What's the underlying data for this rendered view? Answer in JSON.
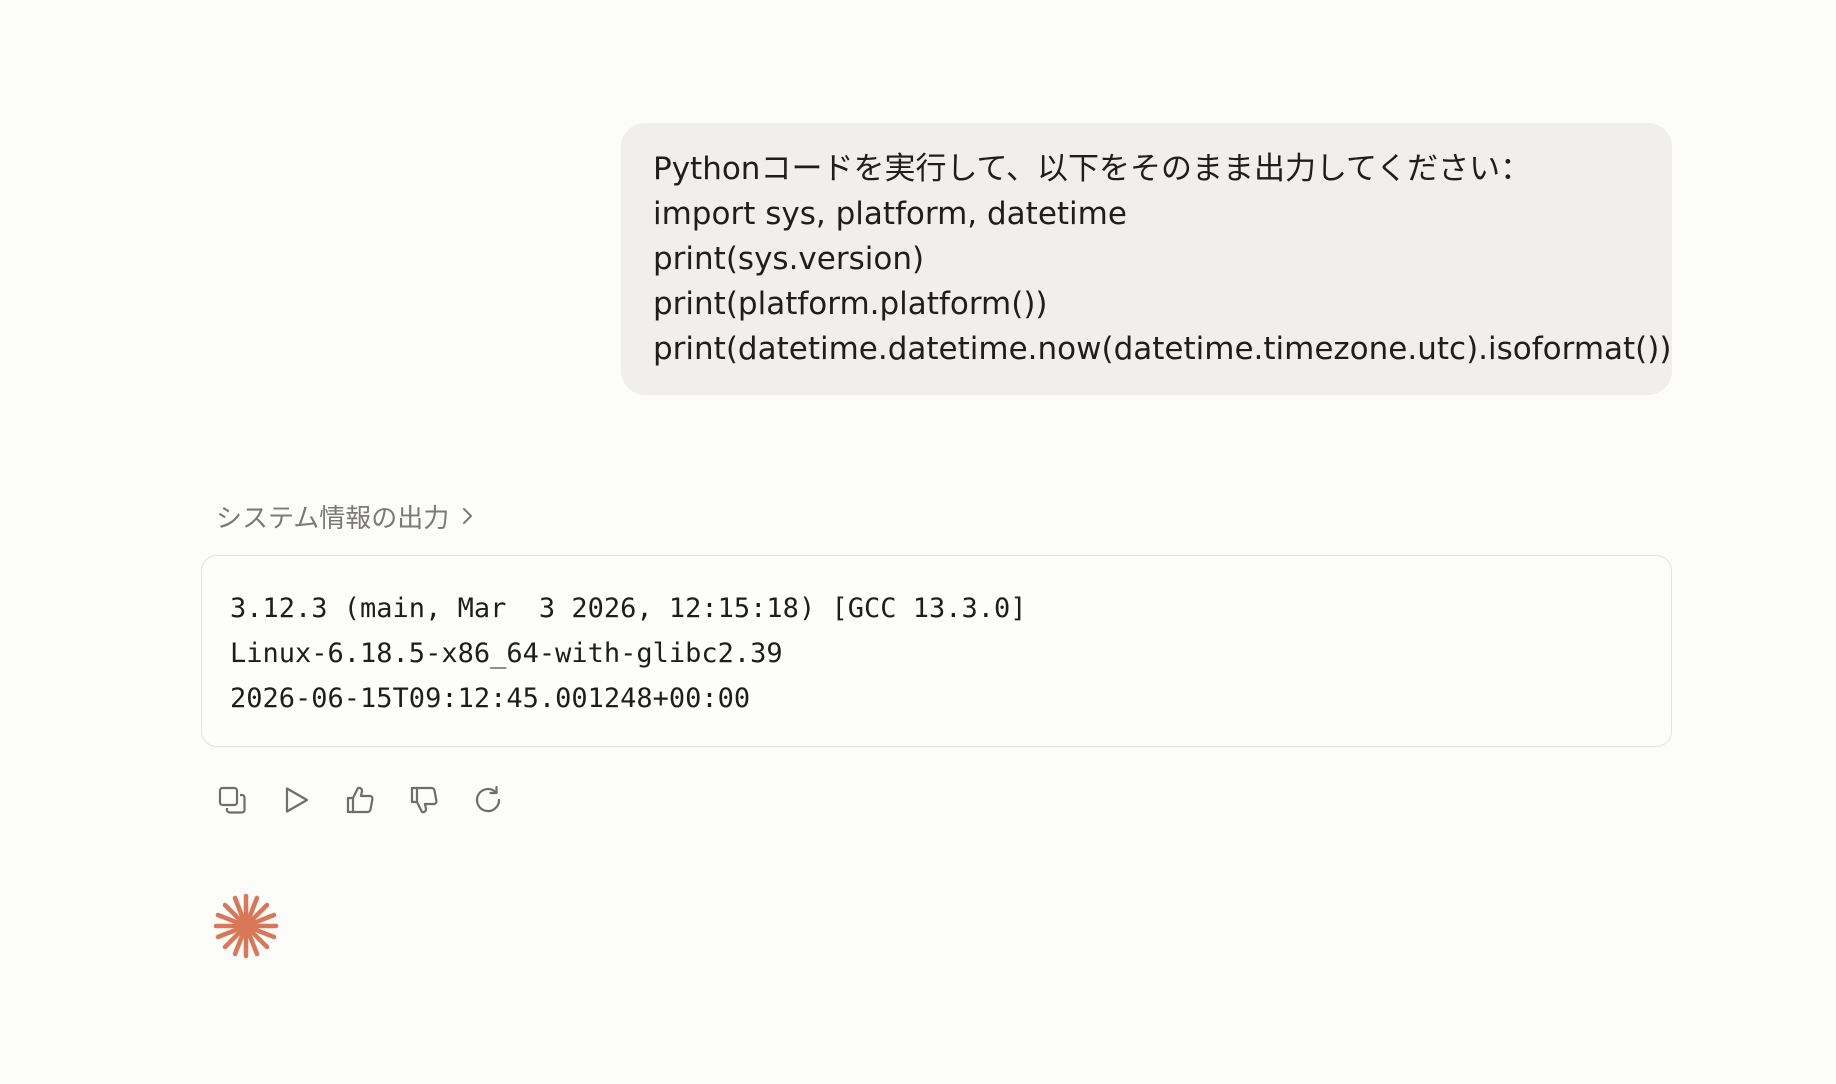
{
  "user_message": {
    "lines": [
      "Pythonコードを実行して、以下をそのまま出力してください：",
      "import sys, platform, datetime",
      "print(sys.version)",
      "print(platform.platform())",
      "print(datetime.datetime.now(datetime.timezone.utc).isoformat())"
    ]
  },
  "assistant": {
    "tool_summary_label": "システム情報の出力",
    "tool_summary_chevron": "chevron-right-icon",
    "output_lines": [
      "3.12.3 (main, Mar  3 2026, 12:15:18) [GCC 13.3.0]",
      "Linux-6.18.5-x86_64-with-glibc2.39",
      "2026-06-15T09:12:45.001248+00:00"
    ],
    "actions": [
      "copy-icon",
      "play-icon",
      "thumbs-up-icon",
      "thumbs-down-icon",
      "retry-icon"
    ],
    "status_icon": "spark-icon",
    "accent_color": "#d97757"
  }
}
